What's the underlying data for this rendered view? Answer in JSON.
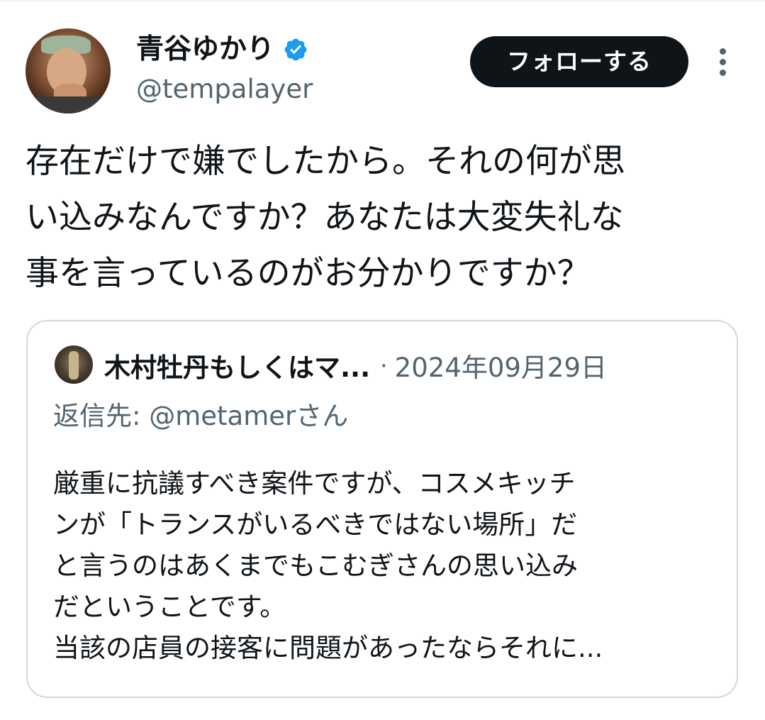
{
  "tweet": {
    "author": {
      "display_name": "青谷ゆかり",
      "handle": "@tempalayer",
      "verified": true
    },
    "follow_label": "フォローする",
    "text": "存在だけで嫌でしたから。それの何が思\nい込みなんですか？あなたは大変失礼な\n事を言っているのがお分かりですか？"
  },
  "quote": {
    "author_name": "木村牡丹もしくはマ...",
    "separator": "·",
    "date": "2024年09月29日",
    "reply_prefix": "返信先: ",
    "reply_handle": "@metamer",
    "reply_suffix": "さん",
    "text": "厳重に抗議すべき案件ですが、コスメキッチ\nンが「トランスがいるべきではない場所」だ\nと言うのはあくまでもこむぎさんの思い込み\nだということです。\n当該の店員の接客に問題があったならそれに..."
  },
  "colors": {
    "verified": "#1d9bf0",
    "follow_button_bg": "#0f1419",
    "follow_button_text": "#ffffff",
    "secondary_text": "#536471",
    "border": "#cfd9de",
    "mention": "#536471"
  },
  "icons": {
    "verified": "verified-badge-icon",
    "more": "more-vertical-icon"
  }
}
